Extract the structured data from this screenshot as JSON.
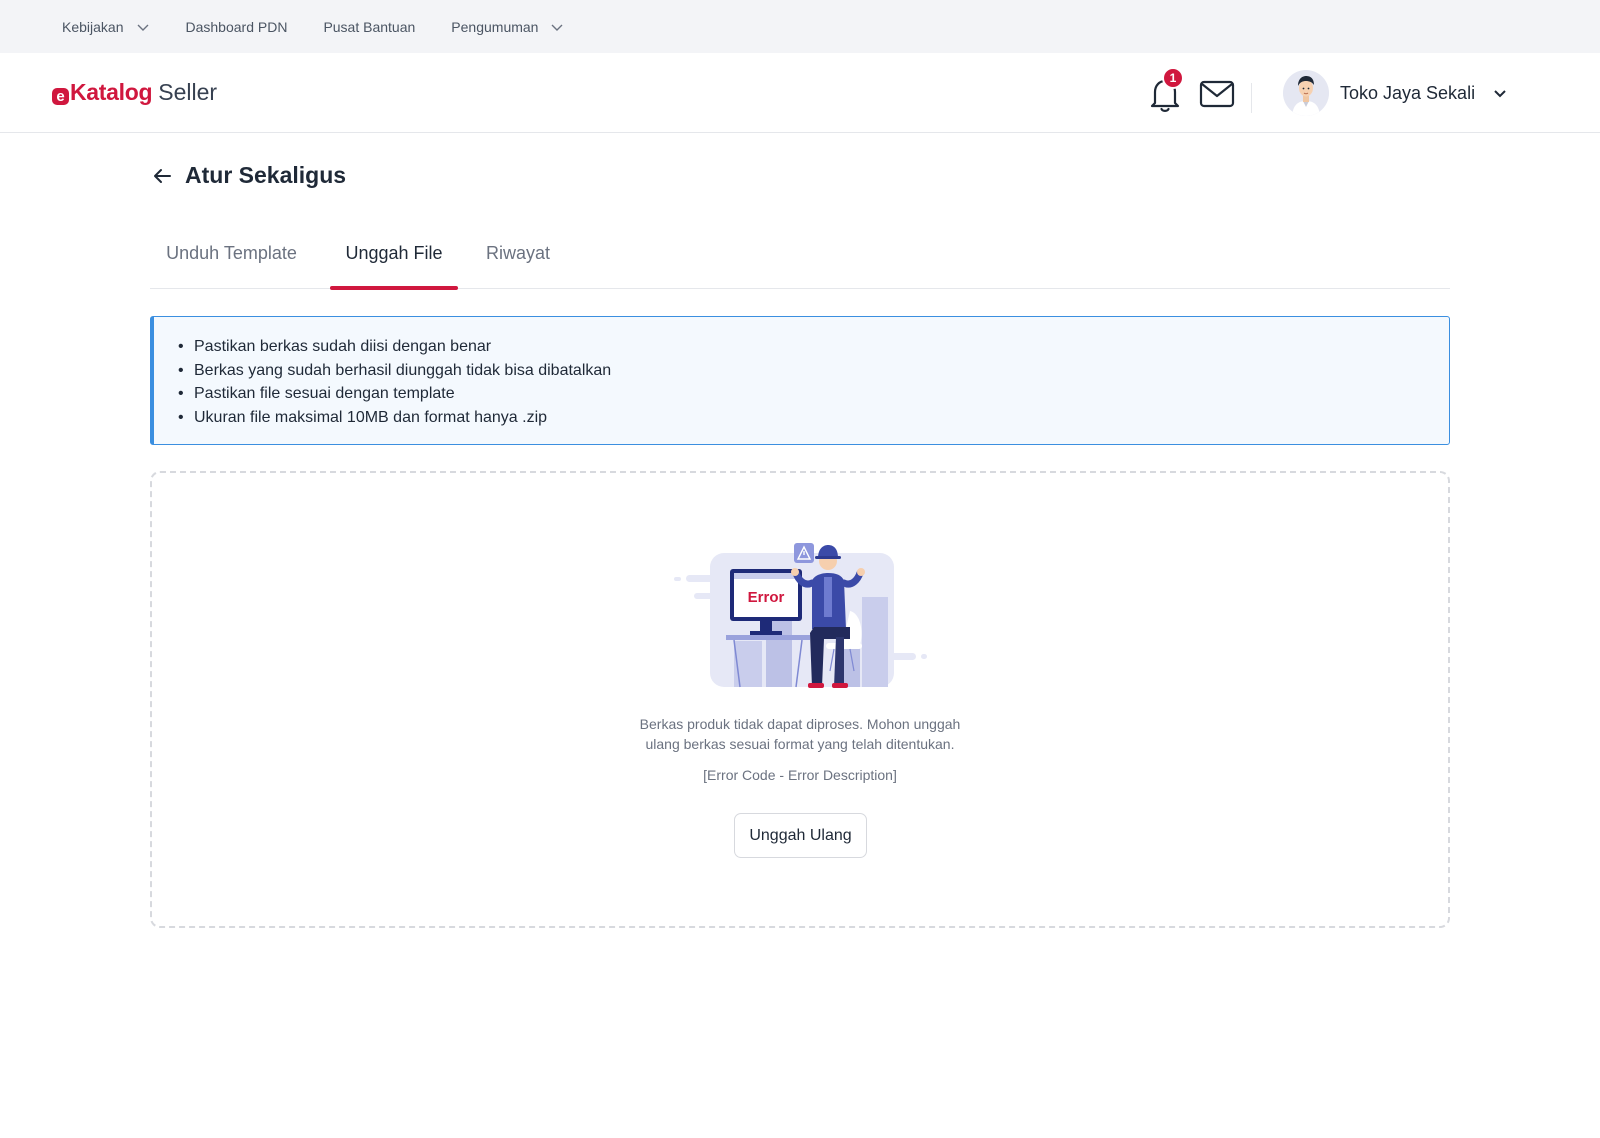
{
  "topnav": {
    "items": [
      {
        "label": "Kebijakan",
        "has_dropdown": true
      },
      {
        "label": "Dashboard PDN",
        "has_dropdown": false
      },
      {
        "label": "Pusat Bantuan",
        "has_dropdown": false
      },
      {
        "label": "Pengumuman",
        "has_dropdown": true
      }
    ]
  },
  "header": {
    "logo_e": "e",
    "logo_brand": "Katalog",
    "logo_sub": "Seller",
    "notification_count": "1",
    "user_name": "Toko Jaya Sekali"
  },
  "page": {
    "title": "Atur Sekaligus"
  },
  "tabs": [
    {
      "label": "Unduh Template",
      "active": false
    },
    {
      "label": "Unggah File",
      "active": true
    },
    {
      "label": "Riwayat",
      "active": false
    }
  ],
  "info": {
    "items": [
      "Pastikan berkas sudah diisi dengan benar",
      "Berkas yang sudah berhasil diunggah tidak bisa dibatalkan",
      "Pastikan file sesuai dengan template",
      "Ukuran file maksimal 10MB dan format hanya .zip"
    ]
  },
  "upload": {
    "illustration_text": "Error",
    "message_line1": "Berkas produk tidak dapat diproses. Mohon unggah",
    "message_line2": "ulang berkas sesuai format yang telah ditentukan.",
    "error_code": "[Error Code - Error Description]",
    "retry_label": "Unggah Ulang"
  },
  "colors": {
    "brand": "#d0173e",
    "info_border": "#3b8fe0",
    "info_bg": "#f4f9fe"
  }
}
